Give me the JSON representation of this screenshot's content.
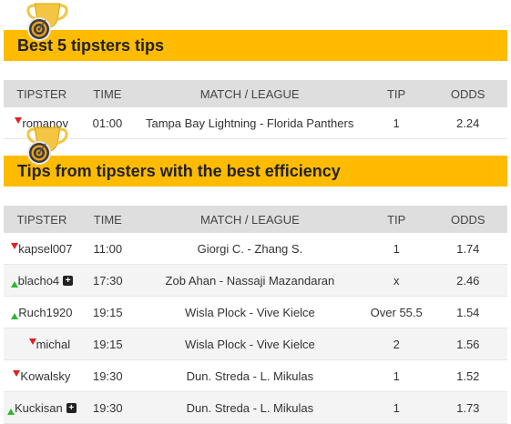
{
  "section1": {
    "title": "Best 5 tipsters tips",
    "trophy_icon": "trophy-target-icon",
    "headers": {
      "tipster": "TIPSTER",
      "time": "TIME",
      "match": "MATCH / LEAGUE",
      "tip": "TIP",
      "odds": "ODDS"
    },
    "rows": [
      {
        "tipster": "romanov",
        "trend": "down",
        "plus": false,
        "time": "01:00",
        "match": "Tampa Bay Lightning - Florida Panthers",
        "tip": "1",
        "odds": "2.24"
      }
    ]
  },
  "section2": {
    "title": "Tips from tipsters with the best efficiency",
    "trophy_icon": "trophy-target-icon",
    "headers": {
      "tipster": "TIPSTER",
      "time": "TIME",
      "match": "MATCH / LEAGUE",
      "tip": "TIP",
      "odds": "ODDS"
    },
    "rows": [
      {
        "tipster": "kapsel007",
        "trend": "down",
        "plus": false,
        "time": "11:00",
        "match": "Giorgi C. - Zhang S.",
        "tip": "1",
        "odds": "1.74"
      },
      {
        "tipster": "blacho4",
        "trend": "up",
        "plus": true,
        "time": "17:30",
        "match": "Zob Ahan - Nassaji Mazandaran",
        "tip": "x",
        "odds": "2.46"
      },
      {
        "tipster": "Ruch1920",
        "trend": "up",
        "plus": false,
        "time": "19:15",
        "match": "Wisla Plock - Vive Kielce",
        "tip": "Over 55.5",
        "odds": "1.54"
      },
      {
        "tipster": "michal",
        "trend": "down",
        "plus": false,
        "time": "19:15",
        "match": "Wisla Plock - Vive Kielce",
        "tip": "2",
        "odds": "1.56"
      },
      {
        "tipster": "Kowalsky",
        "trend": "down",
        "plus": false,
        "time": "19:30",
        "match": "Dun. Streda - L. Mikulas",
        "tip": "1",
        "odds": "1.52"
      },
      {
        "tipster": "Kuckisan",
        "trend": "up",
        "plus": true,
        "time": "19:30",
        "match": "Dun. Streda - L. Mikulas",
        "tip": "1",
        "odds": "1.73"
      }
    ]
  },
  "colors": {
    "banner": "#ffbb00",
    "header_bg": "#dedede",
    "arrow_down": "#e02020",
    "arrow_up": "#2db82d"
  }
}
